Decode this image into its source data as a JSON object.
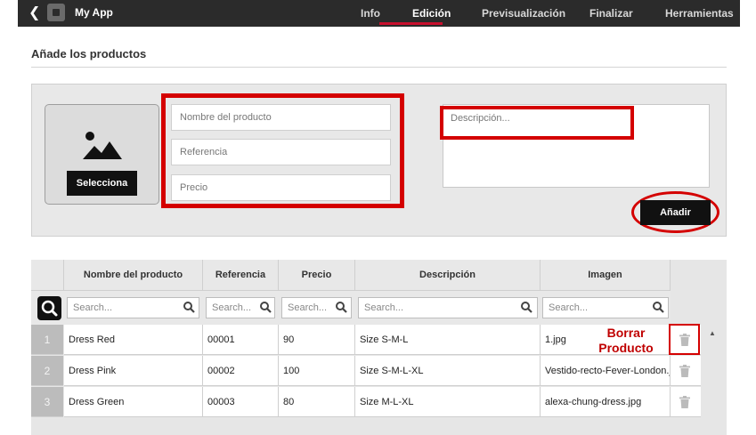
{
  "app": {
    "title": "My App"
  },
  "nav": {
    "tabs": [
      {
        "label": "Info",
        "active": false
      },
      {
        "label": "Edición",
        "active": true
      },
      {
        "label": "Previsualización",
        "active": false
      },
      {
        "label": "Finalizar",
        "active": false
      },
      {
        "label": "Herramientas",
        "active": false
      }
    ]
  },
  "section": {
    "title": "Añade los productos"
  },
  "form": {
    "select_label": "Selecciona",
    "name_placeholder": "Nombre del producto",
    "ref_placeholder": "Referencia",
    "price_placeholder": "Precio",
    "desc_placeholder": "Descripción...",
    "add_label": "Añadir"
  },
  "table": {
    "headers": [
      "Nombre del producto",
      "Referencia",
      "Precio",
      "Descripción",
      "Imagen"
    ],
    "search_placeholder": "Search...",
    "rows": [
      {
        "num": "1",
        "name": "Dress Red",
        "ref": "00001",
        "price": "90",
        "desc": "Size S-M-L",
        "image": "1.jpg"
      },
      {
        "num": "2",
        "name": "Dress Pink",
        "ref": "00002",
        "price": "100",
        "desc": "Size S-M-L-XL",
        "image": "Vestido-recto-Fever-London.jpg"
      },
      {
        "num": "3",
        "name": "Dress Green",
        "ref": "00003",
        "price": "80",
        "desc": "Size M-L-XL",
        "image": "alexa-chung-dress.jpg"
      }
    ]
  },
  "annotation": {
    "line1": "Borrar",
    "line2": "Producto"
  },
  "colors": {
    "accent": "#c8102e",
    "annotation_red": "#d40000",
    "topbar": "#2b2b2b"
  },
  "icons": [
    "back-icon",
    "app-icon",
    "image-placeholder-icon",
    "search-icon",
    "trash-icon",
    "scroll-up-icon"
  ]
}
